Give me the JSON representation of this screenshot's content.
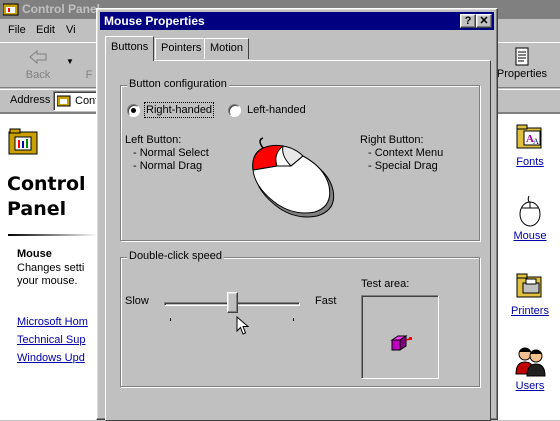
{
  "background_window": {
    "title": "Control Panel",
    "menu": [
      "File",
      "Edit",
      "Vi"
    ],
    "toolbar": {
      "back_label": "Back",
      "forward_label": "F",
      "properties_label": "Properties"
    },
    "address": {
      "label": "Address",
      "value": "Contr"
    },
    "left_pane": {
      "heading": "Control\nPanel",
      "selected_title": "Mouse",
      "selected_description": "Changes setti\nyour mouse.",
      "links": [
        "Microsoft Hom",
        "Technical Sup",
        "Windows Upd"
      ]
    },
    "right_icons": [
      {
        "label": "Fonts",
        "icon": "fonts-folder-icon"
      },
      {
        "label": "Mouse",
        "icon": "mouse-icon"
      },
      {
        "label": "Printers",
        "icon": "printers-folder-icon"
      },
      {
        "label": "Users",
        "icon": "users-icon"
      }
    ]
  },
  "dialog": {
    "title": "Mouse Properties",
    "title_buttons": {
      "help": "?",
      "close": "✕"
    },
    "tabs": [
      {
        "label": "Buttons",
        "active": true
      },
      {
        "label": "Pointers",
        "active": false
      },
      {
        "label": "Motion",
        "active": false
      }
    ],
    "button_configuration": {
      "group_label": "Button configuration",
      "options": [
        {
          "label": "Right-handed",
          "selected": true
        },
        {
          "label": "Left-handed",
          "selected": false
        }
      ],
      "left_button_title": "Left Button:",
      "left_button_items": "- Normal Select\n- Normal Drag",
      "right_button_title": "Right Button:",
      "right_button_items": "- Context Menu\n- Special Drag",
      "highlight_color": "#ff0000"
    },
    "double_click": {
      "group_label": "Double-click speed",
      "slow_label": "Slow",
      "fast_label": "Fast",
      "slider_value": 0.5,
      "test_area_label": "Test area:"
    }
  }
}
